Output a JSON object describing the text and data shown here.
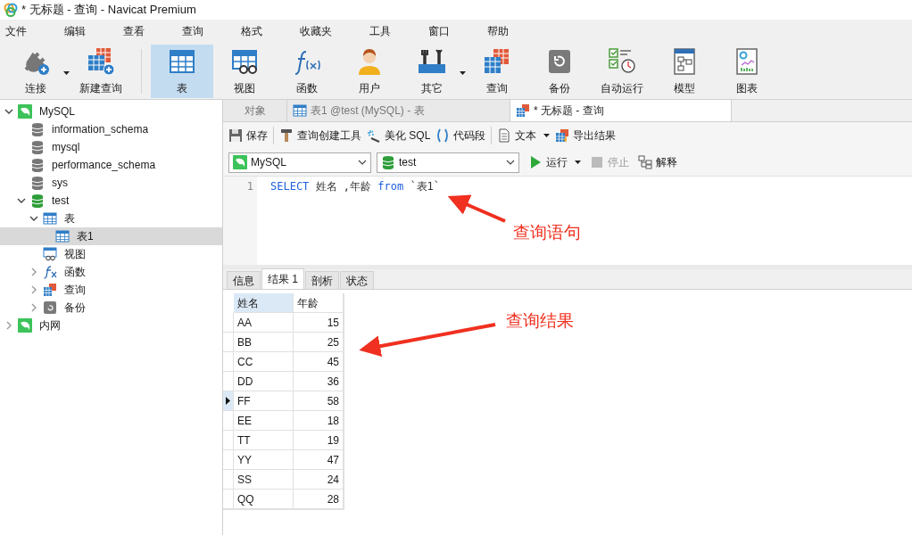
{
  "window": {
    "title": "* 无标题 - 查询 - Navicat Premium"
  },
  "menu": [
    "文件",
    "编辑",
    "查看",
    "查询",
    "格式",
    "收藏夹",
    "工具",
    "窗口",
    "帮助"
  ],
  "toolbar_groups": [
    {
      "items": [
        {
          "label": "连接",
          "kind": "connect",
          "selected": false,
          "dropdown": true
        },
        {
          "label": "新建查询",
          "kind": "new-query",
          "selected": false,
          "dropdown": false
        }
      ]
    },
    {
      "items": [
        {
          "label": "表",
          "kind": "table",
          "selected": true,
          "dropdown": false
        },
        {
          "label": "视图",
          "kind": "view",
          "selected": false,
          "dropdown": false
        },
        {
          "label": "函数",
          "kind": "function",
          "selected": false,
          "dropdown": false
        },
        {
          "label": "用户",
          "kind": "user",
          "selected": false,
          "dropdown": false
        },
        {
          "label": "其它",
          "kind": "tools",
          "selected": false,
          "dropdown": true
        },
        {
          "label": "查询",
          "kind": "query",
          "selected": false,
          "dropdown": false
        },
        {
          "label": "备份",
          "kind": "backup",
          "selected": false,
          "dropdown": false
        },
        {
          "label": "自动运行",
          "kind": "schedule",
          "selected": false,
          "dropdown": false
        },
        {
          "label": "模型",
          "kind": "model",
          "selected": false,
          "dropdown": false
        },
        {
          "label": "图表",
          "kind": "chart",
          "selected": false,
          "dropdown": false
        }
      ]
    }
  ],
  "tree": [
    {
      "label": "MySQL",
      "kind": "connection",
      "expanded": true,
      "selected": false,
      "children": [
        {
          "label": "information_schema",
          "kind": "database",
          "selected": false
        },
        {
          "label": "mysql",
          "kind": "database",
          "selected": false
        },
        {
          "label": "performance_schema",
          "kind": "database",
          "selected": false
        },
        {
          "label": "sys",
          "kind": "database",
          "selected": false
        },
        {
          "label": "test",
          "kind": "database-open",
          "expanded": true,
          "selected": false,
          "children": [
            {
              "label": "表",
              "kind": "table",
              "expanded": true,
              "selected": false,
              "children": [
                {
                  "label": "表1",
                  "kind": "table",
                  "selected": true
                }
              ]
            },
            {
              "label": "视图",
              "kind": "view",
              "selected": false
            },
            {
              "label": "函数",
              "kind": "function",
              "expanded": false,
              "selected": false
            },
            {
              "label": "查询",
              "kind": "query",
              "expanded": false,
              "selected": false
            },
            {
              "label": "备份",
              "kind": "backup",
              "expanded": false,
              "selected": false
            }
          ]
        }
      ]
    },
    {
      "label": "内网",
      "kind": "connection",
      "expanded": false,
      "selected": false
    }
  ],
  "doc_tabs": [
    {
      "label": "对象",
      "kind": "objects",
      "selected": false
    },
    {
      "label": "表1 @test (MySQL) - 表",
      "kind": "table",
      "selected": false
    },
    {
      "label": "* 无标题 - 查询",
      "kind": "query",
      "selected": true
    }
  ],
  "query_toolbar_groups": [
    {
      "items": [
        {
          "label": "保存",
          "kind": "save",
          "dropdown": false
        }
      ]
    },
    {
      "items": [
        {
          "label": "查询创建工具",
          "kind": "builder",
          "dropdown": false
        },
        {
          "label": "美化 SQL",
          "kind": "beautify",
          "dropdown": false
        },
        {
          "label": "代码段",
          "kind": "snippet",
          "dropdown": false
        }
      ]
    },
    {
      "items": [
        {
          "label": "文本",
          "kind": "text",
          "dropdown": true
        },
        {
          "label": "导出结果",
          "kind": "export",
          "dropdown": false
        }
      ]
    }
  ],
  "connection_select": {
    "value": "MySQL"
  },
  "database_select": {
    "value": "test"
  },
  "run_controls": [
    {
      "label": "运行",
      "kind": "run",
      "dropdown": true,
      "disabled": false
    },
    {
      "label": "停止",
      "kind": "stop",
      "dropdown": false,
      "disabled": true
    },
    {
      "label": "解释",
      "kind": "explain",
      "dropdown": false,
      "disabled": false
    }
  ],
  "editor": {
    "lines": [
      {
        "number": "1",
        "tokens": [
          {
            "text": "SELECT",
            "kind": "keyword"
          },
          {
            "text": " 姓名 ,年龄 ",
            "kind": "text"
          },
          {
            "text": "from",
            "kind": "keyword"
          },
          {
            "text": " `表1`",
            "kind": "text"
          }
        ]
      }
    ]
  },
  "result_tabs": [
    {
      "label": "信息",
      "selected": false
    },
    {
      "label": "结果 1",
      "selected": true
    },
    {
      "label": "剖析",
      "selected": false
    },
    {
      "label": "状态",
      "selected": false
    }
  ],
  "table": {
    "columns": [
      {
        "label": "姓名",
        "selected": true
      },
      {
        "label": "年龄",
        "selected": false
      }
    ],
    "rows": [
      {
        "cells": [
          "AA",
          "15"
        ],
        "selected": false
      },
      {
        "cells": [
          "BB",
          "25"
        ],
        "selected": false
      },
      {
        "cells": [
          "CC",
          "45"
        ],
        "selected": false
      },
      {
        "cells": [
          "DD",
          "36"
        ],
        "selected": false
      },
      {
        "cells": [
          "FF",
          "58"
        ],
        "selected": true
      },
      {
        "cells": [
          "EE",
          "18"
        ],
        "selected": false
      },
      {
        "cells": [
          "TT",
          "19"
        ],
        "selected": false
      },
      {
        "cells": [
          "YY",
          "47"
        ],
        "selected": false
      },
      {
        "cells": [
          "SS",
          "24"
        ],
        "selected": false
      },
      {
        "cells": [
          "QQ",
          "28"
        ],
        "selected": false
      }
    ]
  },
  "annotations": [
    {
      "text": "查询语句"
    },
    {
      "text": "查询结果"
    }
  ]
}
